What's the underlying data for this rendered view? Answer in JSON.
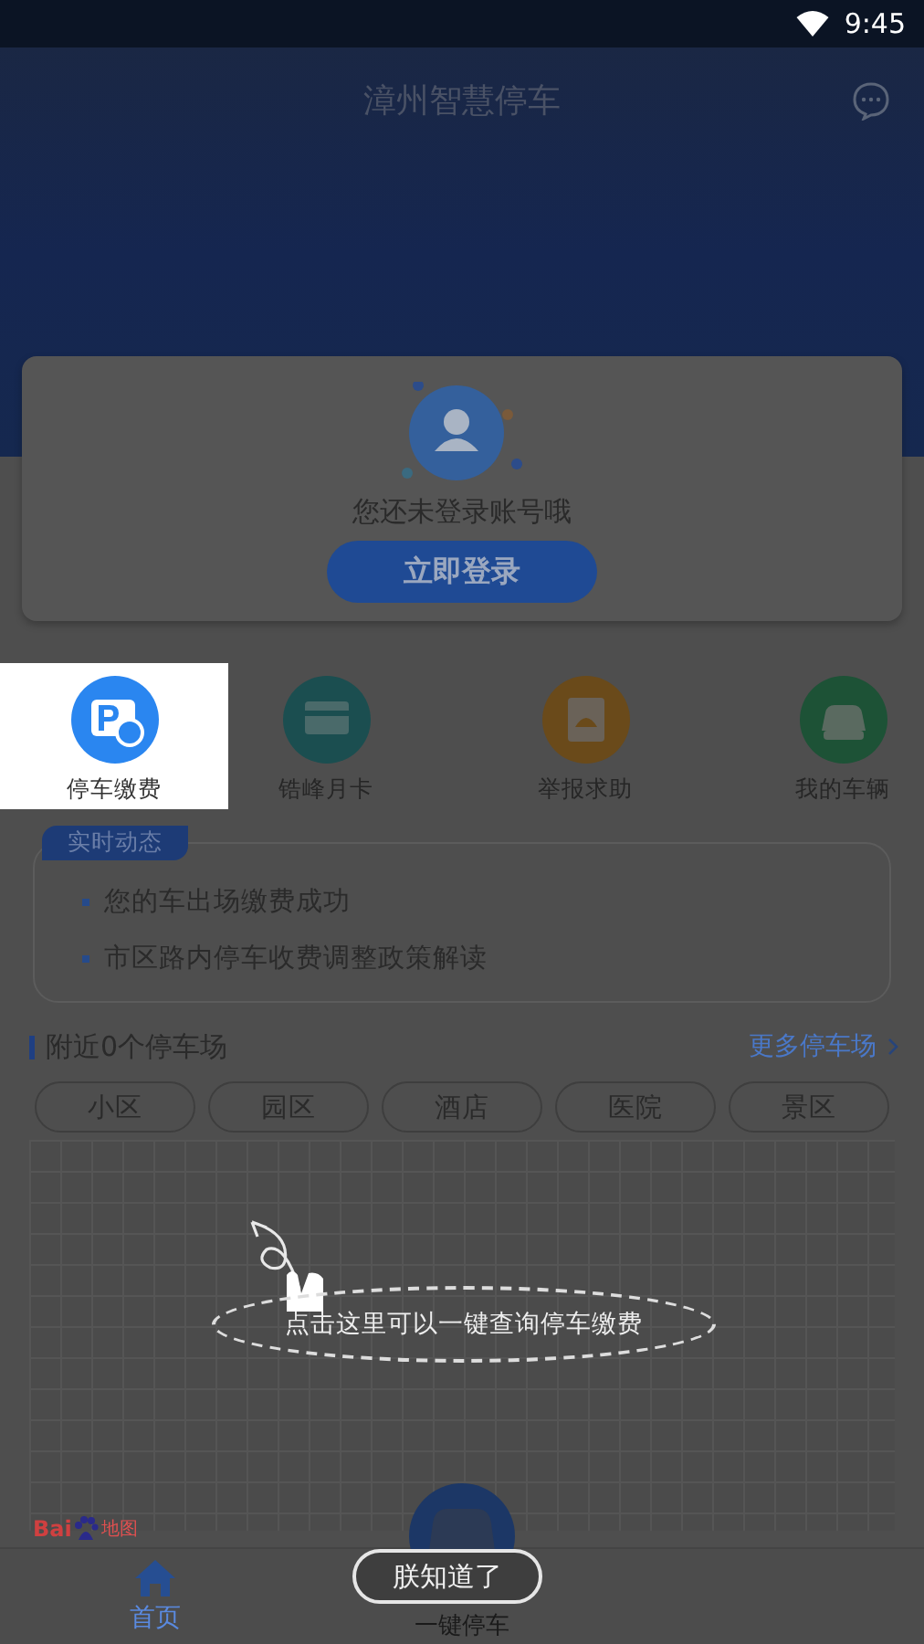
{
  "status_bar": {
    "time": "9:45"
  },
  "header": {
    "title": "漳州智慧停车"
  },
  "login_card": {
    "message": "您还未登录账号哦",
    "button": "立即登录"
  },
  "shortcuts": [
    {
      "label": "停车缴费",
      "kind": "pay",
      "highlighted": true
    },
    {
      "label": "锆峰月卡",
      "kind": "card",
      "highlighted": false
    },
    {
      "label": "举报求助",
      "kind": "report",
      "highlighted": false
    },
    {
      "label": "我的车辆",
      "kind": "car",
      "highlighted": false
    }
  ],
  "news": {
    "tag": "实时动态",
    "items": [
      "您的车出场缴费成功",
      "市区路内停车收费调整政策解读"
    ]
  },
  "nearby": {
    "title": "附近0个停车场",
    "more": "更多停车场"
  },
  "categories": [
    "小区",
    "园区",
    "酒店",
    "医院",
    "景区"
  ],
  "map": {
    "logo_text": "Bai",
    "logo_suffix": "地图"
  },
  "guide": {
    "hint": "点击这里可以一键查询停车缴费",
    "dismiss": "朕知道了"
  },
  "bottom_nav": [
    {
      "label": "首页",
      "kind": "home",
      "selected": true
    },
    {
      "label": "一键停车",
      "kind": "center",
      "selected": false
    }
  ]
}
